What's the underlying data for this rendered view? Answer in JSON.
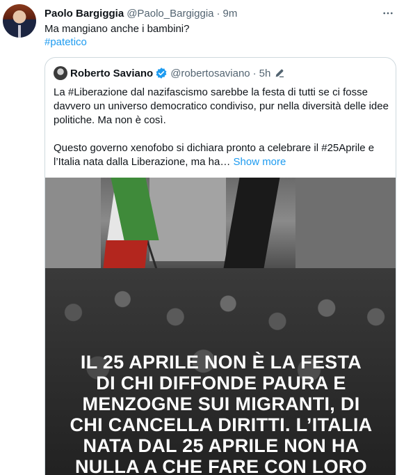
{
  "tweet": {
    "author_name": "Paolo Bargiggia",
    "author_handle": "@Paolo_Bargiggia",
    "separator": "·",
    "time": "9m",
    "text": "Ma mangiano anche i bambini?",
    "hashtag": "#patetico",
    "more_icon": "more-horizontal-icon"
  },
  "quote": {
    "author_name": "Roberto Saviano",
    "verified_icon": "verified-badge-icon",
    "author_handle": "@robertosaviano",
    "separator": "·",
    "time": "5h",
    "edit_icon": "edited-pencil-icon",
    "paragraph1": "La #Liberazione dal nazifascismo sarebbe la festa di tutti se ci fosse davvero un universo democratico condiviso, pur nella diversità delle idee politiche. Ma non è così.",
    "paragraph2": "Questo governo xenofobo si dichiara pronto a celebrare il #25Aprile e l’Italia nata dalla Liberazione, ma ha…",
    "show_more": "Show more",
    "image_text_lines": [
      "IL 25 APRILE NON È LA FESTA",
      "DI CHI DIFFONDE PAURA E",
      "MENZOGNE SUI MIGRANTI, DI",
      "CHI CANCELLA DIRITTI. L’ITALIA",
      "NATA DAL 25 APRILE NON HA",
      "NULLA A CHE FARE CON LORO"
    ]
  },
  "colors": {
    "link": "#1d9bf0",
    "secondary_text": "#536471",
    "border": "#cfd9de"
  }
}
